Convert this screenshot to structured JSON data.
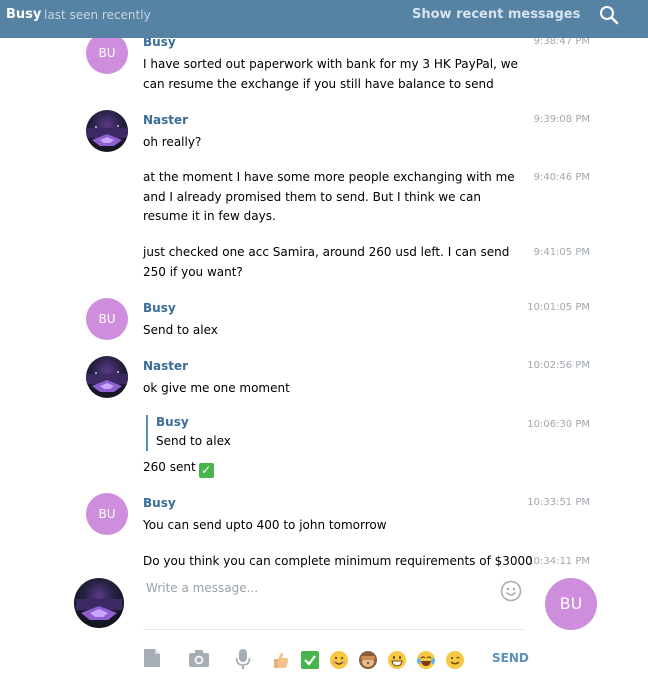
{
  "header": {
    "name": "Busy",
    "status": "last seen recently",
    "recent_link": "Show recent messages"
  },
  "messages": [
    {
      "sender": "Busy",
      "time": "9:38:47 PM",
      "text": "I have sorted out paperwork with bank for my 3 HK PayPal, we can resume the exchange if you still have balance to send"
    },
    {
      "sender": "Naster",
      "time": "9:39:08 PM",
      "text": "oh really?"
    },
    {
      "time": "9:40:46 PM",
      "text": "at the moment I have some more people exchanging with me and I already promised them to send. But I think we can resume it in few days."
    },
    {
      "time": "9:41:05 PM",
      "text": "just checked one acc Samira, around 260 usd left. I can send 250 if you want?"
    },
    {
      "sender": "Busy",
      "time": "10:01:05 PM",
      "text": "Send to alex"
    },
    {
      "sender": "Naster",
      "time": "10:02:56 PM",
      "text": "ok give me one moment"
    },
    {
      "time": "10:06:30 PM",
      "reply_sender": "Busy",
      "reply_text": "Send to alex",
      "text": "260 sent"
    },
    {
      "sender": "Busy",
      "time": "10:33:51 PM",
      "text": "You can send upto 400 to john tomorrow"
    },
    {
      "time": "10:34:11 PM",
      "text": "Do you think you can complete minimum requirements of $3000"
    }
  ],
  "avatars": {
    "busy_initials": "BU",
    "me_initials": "BU"
  },
  "composer": {
    "placeholder": "Write a message...",
    "send_label": "SEND"
  },
  "colors": {
    "header_bg": "#5682a3",
    "sender_name": "#3a6d99",
    "busy_avatar": "#cf8ddd",
    "send_button": "#5a8fbd"
  },
  "icons": [
    "search-icon",
    "emoji-icon",
    "file-icon",
    "camera-icon",
    "microphone-icon"
  ],
  "quick_emojis": [
    "thumbs-up",
    "check-mark",
    "smiling-face",
    "see-no-evil-monkey",
    "grinning-face",
    "tears-of-joy-face",
    "winking-face"
  ]
}
